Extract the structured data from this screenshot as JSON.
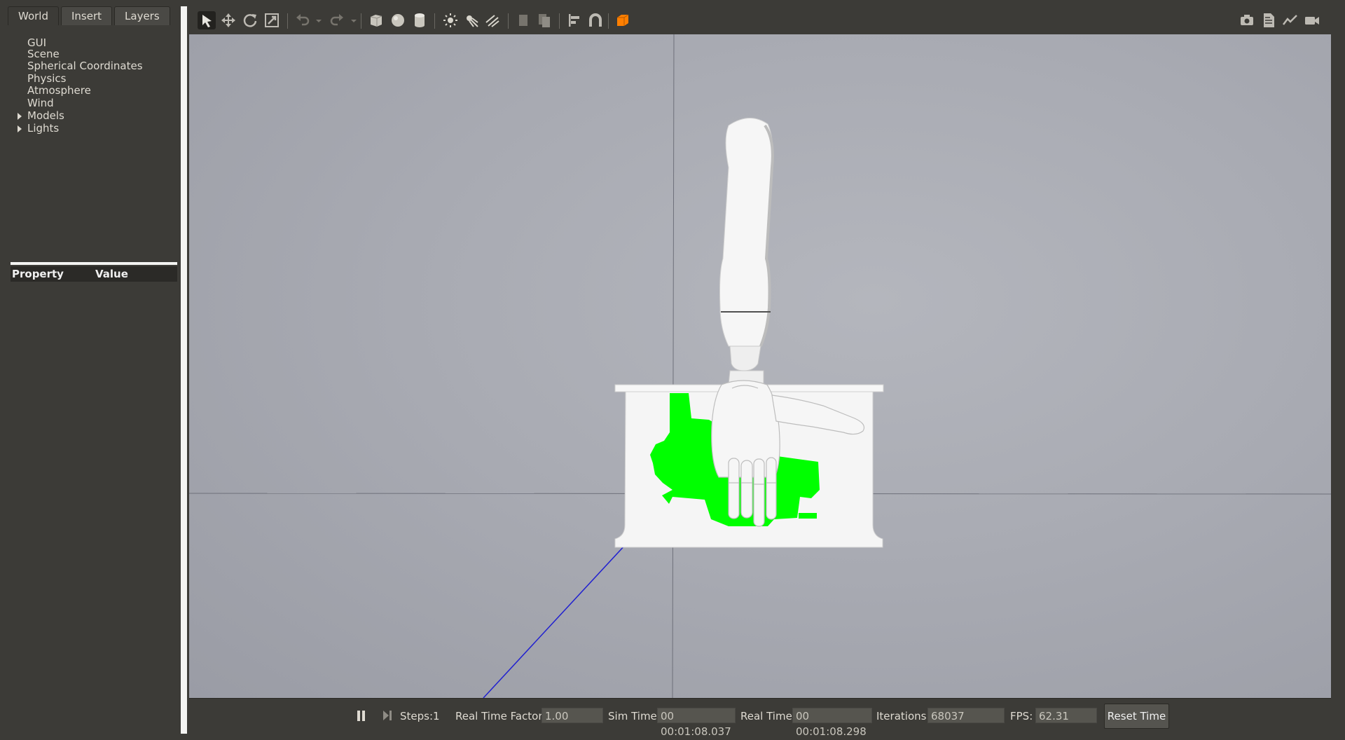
{
  "left_panel": {
    "tabs": [
      {
        "label": "World",
        "active": true
      },
      {
        "label": "Insert",
        "active": false
      },
      {
        "label": "Layers",
        "active": false
      }
    ],
    "tree": [
      {
        "label": "GUI",
        "expandable": false
      },
      {
        "label": "Scene",
        "expandable": false
      },
      {
        "label": "Spherical Coordinates",
        "expandable": false
      },
      {
        "label": "Physics",
        "expandable": false
      },
      {
        "label": "Atmosphere",
        "expandable": false
      },
      {
        "label": "Wind",
        "expandable": false
      },
      {
        "label": "Models",
        "expandable": true
      },
      {
        "label": "Lights",
        "expandable": true
      }
    ],
    "property_header": {
      "property": "Property",
      "value": "Value"
    }
  },
  "toolbar": {
    "tools": [
      {
        "icon": "select-arrow-icon",
        "active": true
      },
      {
        "icon": "translate-icon"
      },
      {
        "icon": "rotate-icon"
      },
      {
        "icon": "scale-icon"
      },
      {
        "icon": "undo-icon"
      },
      {
        "icon": "dropdown-icon"
      },
      {
        "icon": "redo-icon"
      },
      {
        "icon": "dropdown-icon"
      },
      {
        "icon": "box-shape-icon"
      },
      {
        "icon": "sphere-shape-icon"
      },
      {
        "icon": "cylinder-shape-icon"
      },
      {
        "icon": "point-light-icon"
      },
      {
        "icon": "spot-light-icon"
      },
      {
        "icon": "directional-light-icon"
      },
      {
        "icon": "copy-icon"
      },
      {
        "icon": "paste-icon"
      },
      {
        "icon": "align-icon"
      },
      {
        "icon": "snap-magnet-icon"
      },
      {
        "icon": "view-angle-icon"
      },
      {
        "icon": "screenshot-camera-icon"
      },
      {
        "icon": "log-icon"
      },
      {
        "icon": "plot-icon"
      },
      {
        "icon": "video-record-icon"
      }
    ]
  },
  "bottom_bar": {
    "steps_label": "Steps:",
    "steps_value": "1",
    "rtf_label": "Real Time Factor:",
    "rtf_value": "1.00",
    "sim_time_label": "Sim Time:",
    "sim_time_value": "00 00:01:08.037",
    "real_time_label": "Real Time:",
    "real_time_value": "00 00:01:08.298",
    "iterations_label": "Iterations:",
    "iterations_value": "68037",
    "fps_label": "FPS:",
    "fps_value": "62.31",
    "reset_label": "Reset Time"
  },
  "colors": {
    "panel_bg": "#3c3b37",
    "viewport_bg": "#a9abb3",
    "highlight_green": "#00ff00",
    "model_white": "#f5f5f5",
    "axis_blue": "#2020d0",
    "active_tool_accent": "#ff7f00"
  }
}
